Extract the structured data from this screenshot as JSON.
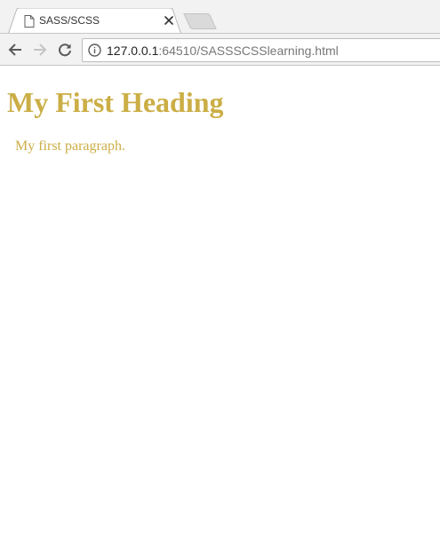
{
  "tab": {
    "title": "SASS/SCSS"
  },
  "address_bar": {
    "host": "127.0.0.1",
    "rest": ":64510/SASSSCSSlearning.html"
  },
  "page": {
    "heading": "My First Heading",
    "paragraph": "My first paragraph.",
    "text_color": "#cbae45"
  },
  "icons": {
    "tab_favicon": "page-icon",
    "tab_close": "close-icon",
    "new_tab": "new-tab-icon",
    "back": "back-arrow-icon",
    "forward": "forward-arrow-icon",
    "reload": "reload-icon",
    "site_info": "info-icon"
  }
}
